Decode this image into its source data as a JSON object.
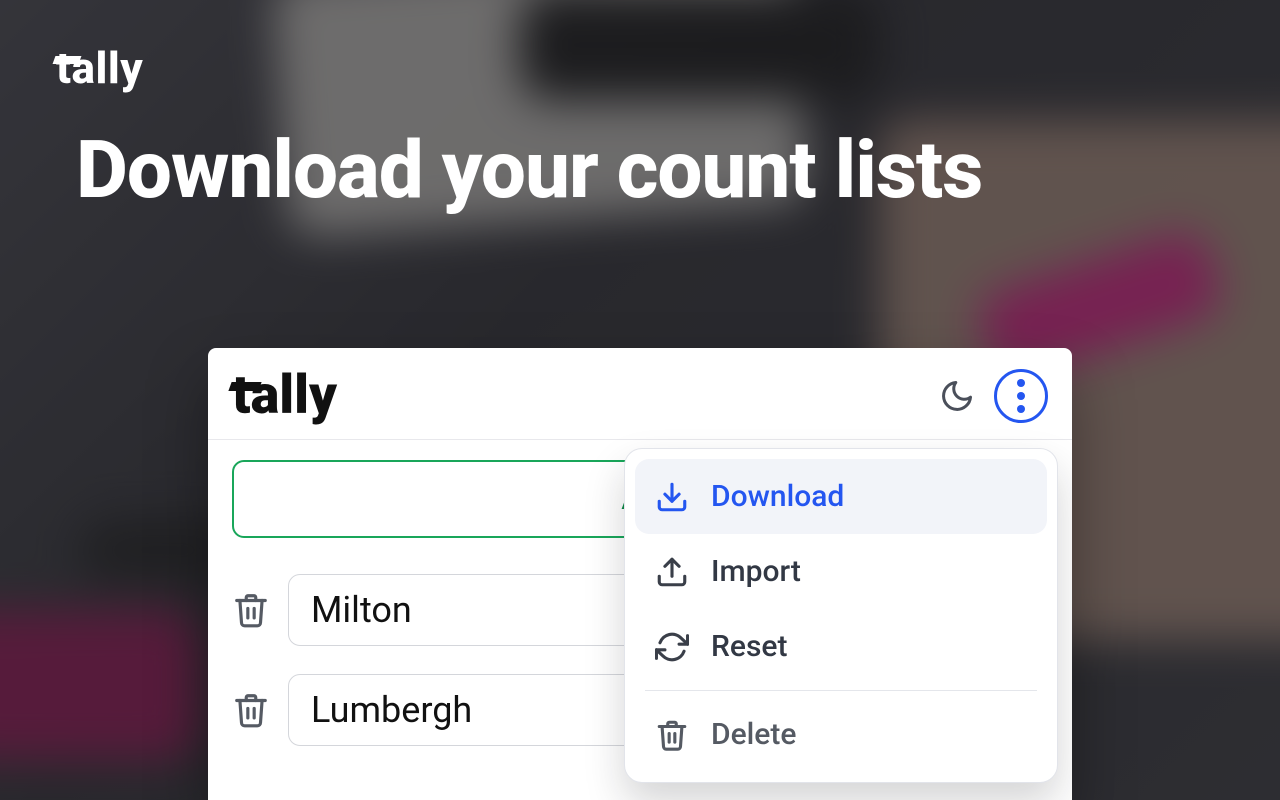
{
  "hero": {
    "brand": "tally",
    "title": "Download your count lists"
  },
  "app": {
    "brand": "tally",
    "add_label": "Ad",
    "rows": [
      {
        "name": "Milton"
      },
      {
        "name": "Lumbergh"
      }
    ]
  },
  "menu": {
    "items": [
      {
        "key": "download",
        "label": "Download",
        "active": true
      },
      {
        "key": "import",
        "label": "Import"
      },
      {
        "key": "reset",
        "label": "Reset"
      },
      {
        "key": "delete",
        "label": "Delete"
      }
    ]
  },
  "icons": {
    "moon": "moon-icon",
    "kebab": "kebab-icon",
    "trash": "trash-icon",
    "download": "download-icon",
    "import": "upload-icon",
    "reset": "refresh-icon",
    "delete": "trash-icon"
  }
}
